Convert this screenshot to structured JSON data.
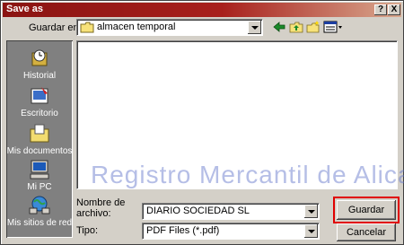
{
  "window": {
    "title": "Save as",
    "help_label": "?",
    "close_label": "X"
  },
  "toolbar": {
    "save_in_label": "Guardar en:",
    "save_in_value": "almacen temporal",
    "icons": [
      "back-arrow-icon",
      "up-folder-icon",
      "new-folder-icon",
      "view-menu-icon"
    ]
  },
  "places": [
    {
      "label": "Historial",
      "icon": "history-icon"
    },
    {
      "label": "Escritorio",
      "icon": "desktop-icon"
    },
    {
      "label": "Mis documentos",
      "icon": "documents-folder-icon"
    },
    {
      "label": "Mi PC",
      "icon": "computer-icon"
    },
    {
      "label": "Mis sitios de red",
      "icon": "network-icon"
    }
  ],
  "filename": {
    "label_line1": "Nombre de",
    "label_line2": "archivo:",
    "value": "DIARIO SOCIEDAD SL"
  },
  "filetype": {
    "label": "Tipo:",
    "value": "PDF Files (*.pdf)"
  },
  "buttons": {
    "save": "Guardar",
    "cancel": "Cancelar"
  },
  "watermark": "Registro Mercantil de Alicante",
  "colors": {
    "titlebar": "#8a1412",
    "highlight": "#e00000",
    "face": "#d4d0c8"
  }
}
